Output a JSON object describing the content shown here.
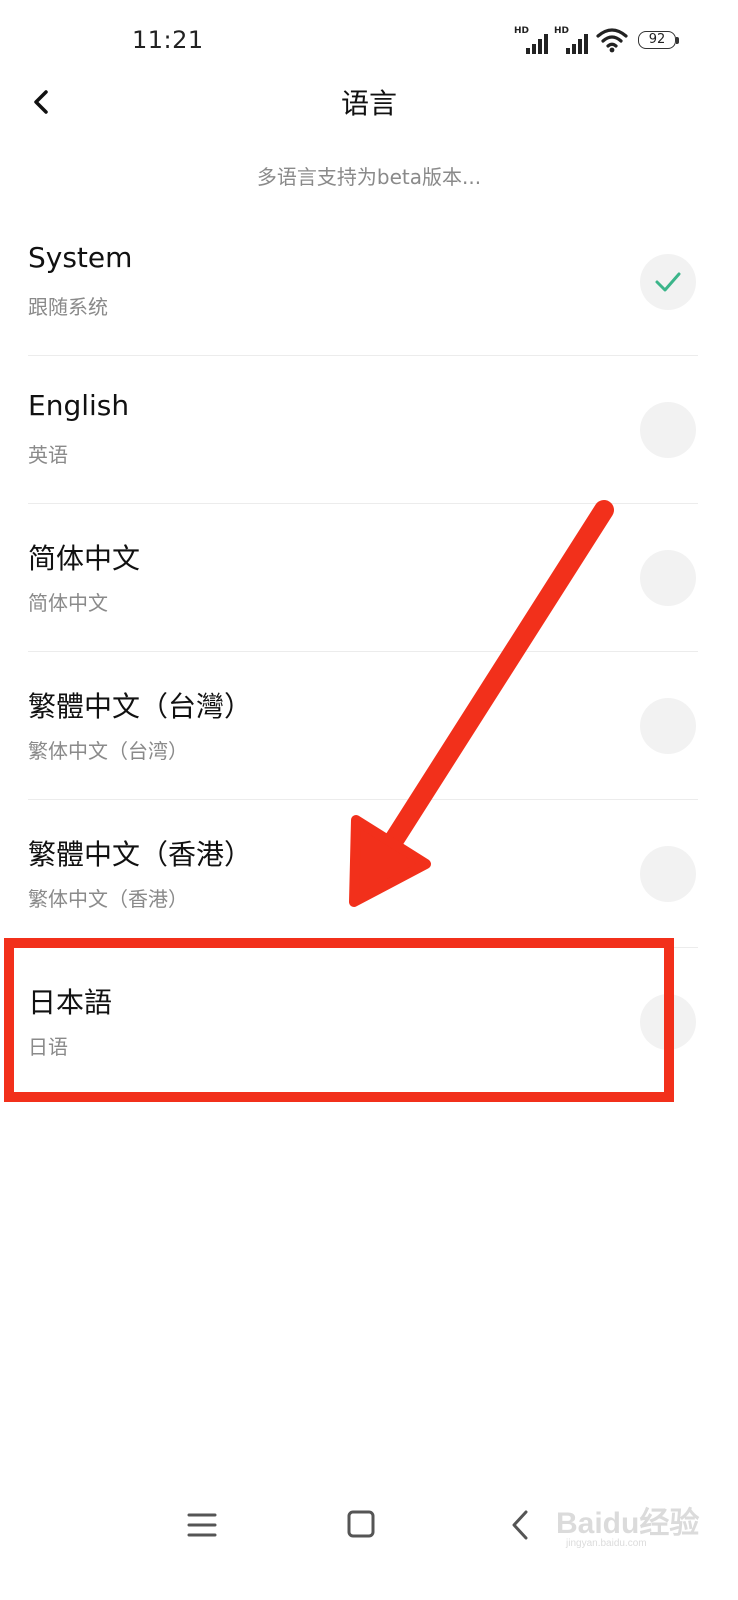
{
  "status_bar": {
    "time": "11:21",
    "signal_label_1": "HD",
    "signal_label_2": "HD",
    "battery": "92",
    "wifi_icon": "wifi-icon"
  },
  "header": {
    "title": "语言",
    "back_icon": "chevron-left-icon"
  },
  "beta_note": "多语言支持为beta版本...",
  "languages": [
    {
      "name": "System",
      "sub": "跟随系统",
      "selected": true
    },
    {
      "name": "English",
      "sub": "英语",
      "selected": false
    },
    {
      "name": "简体中文",
      "sub": "简体中文",
      "selected": false
    },
    {
      "name": "繁體中文（台灣）",
      "sub": "繁体中文（台湾）",
      "selected": false
    },
    {
      "name": "繁體中文（香港）",
      "sub": "繁体中文（香港）",
      "selected": false
    },
    {
      "name": "日本語",
      "sub": "日语",
      "selected": false
    }
  ],
  "colors": {
    "check": "#3bb58a",
    "annotation": "#f2301b",
    "radio_bg": "#f2f2f2"
  },
  "nav_bar": {
    "menu_icon": "menu-icon",
    "home_icon": "square-icon",
    "back_icon": "back-triangle-icon"
  },
  "watermark": {
    "main": "Baidu经验",
    "sub": "jingyan.baidu.com"
  }
}
